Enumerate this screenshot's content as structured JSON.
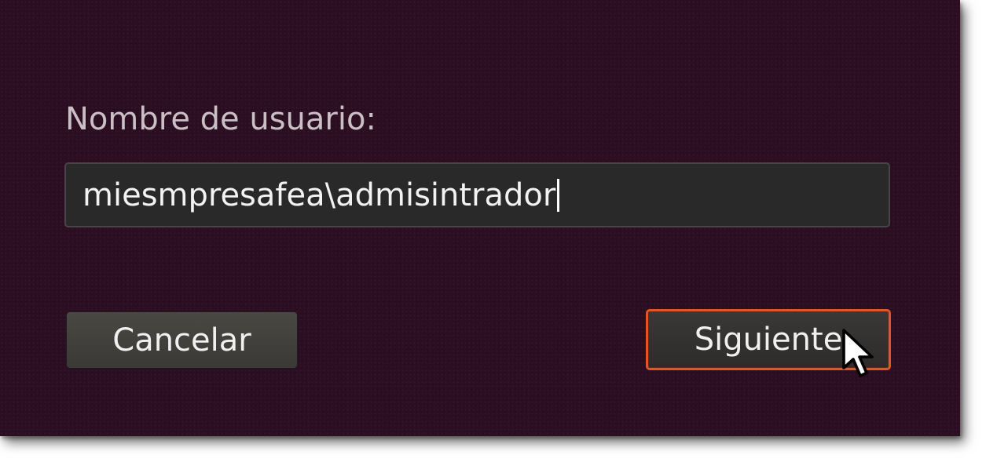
{
  "dialog": {
    "username_label": "Nombre de usuario:",
    "username_value": "miesmpresafea\\admisintrador",
    "cancel_label": "Cancelar",
    "next_label": "Siguiente"
  },
  "colors": {
    "background": "#2c0e22",
    "input_background": "#292929",
    "focus_accent": "#e0562a",
    "label_text": "#c9bfc4",
    "button_text": "#f0f0f0"
  },
  "icons": {
    "pointer": "mouse-pointer-icon"
  }
}
